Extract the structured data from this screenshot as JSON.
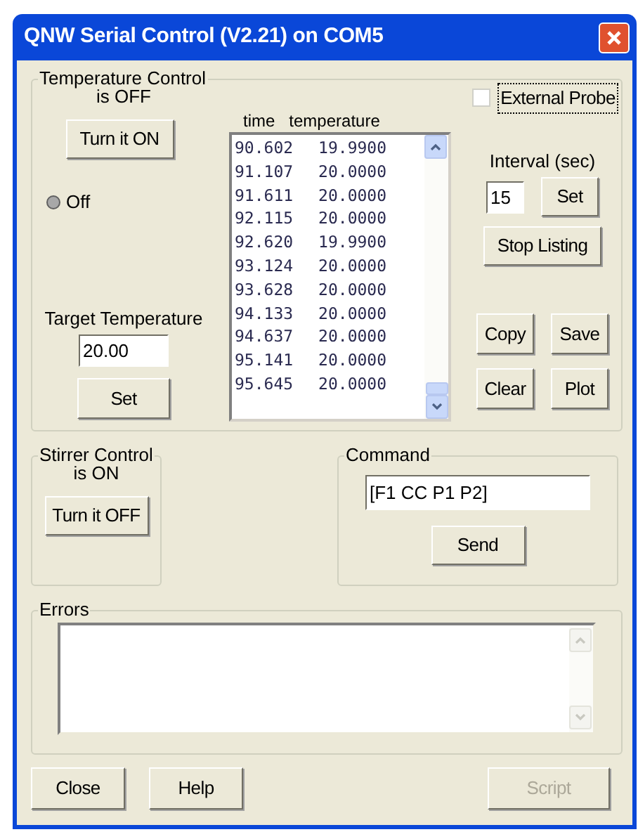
{
  "window": {
    "title": "QNW Serial Control (V2.21)  on COM5"
  },
  "temperature_control": {
    "title": "Temperature Control",
    "status": "is OFF",
    "toggle_button": "Turn it ON",
    "indicator": {
      "label": "Off",
      "on": false
    },
    "target_label": "Target Temperature",
    "target_value": "20.00",
    "set_button": "Set"
  },
  "listing": {
    "columns": [
      "time",
      "temperature"
    ],
    "rows": [
      [
        "90.602",
        "19.9900"
      ],
      [
        "91.107",
        "20.0000"
      ],
      [
        "91.611",
        "20.0000"
      ],
      [
        "92.115",
        "20.0000"
      ],
      [
        "92.620",
        "19.9900"
      ],
      [
        "93.124",
        "20.0000"
      ],
      [
        "93.628",
        "20.0000"
      ],
      [
        "94.133",
        "20.0000"
      ],
      [
        "94.637",
        "20.0000"
      ],
      [
        "95.141",
        "20.0000"
      ],
      [
        "95.645",
        "20.0000"
      ]
    ]
  },
  "external_probe": {
    "label": "External Probe",
    "checked": false
  },
  "interval": {
    "label": "Interval (sec)",
    "value": "15",
    "set_button": "Set"
  },
  "stop_button": "Stop Listing",
  "actions": [
    "Copy",
    "Save",
    "Clear",
    "Plot"
  ],
  "stirrer_control": {
    "title": "Stirrer Control",
    "status": "is ON",
    "toggle_button": "Turn it OFF"
  },
  "command": {
    "title": "Command",
    "value": "[F1 CC P1 P2]",
    "send_button": "Send"
  },
  "errors": {
    "title": "Errors"
  },
  "buttons": [
    {
      "label": "Close",
      "disabled": false
    },
    {
      "label": "Help",
      "disabled": false
    },
    {
      "label": "Script",
      "disabled": true
    }
  ]
}
